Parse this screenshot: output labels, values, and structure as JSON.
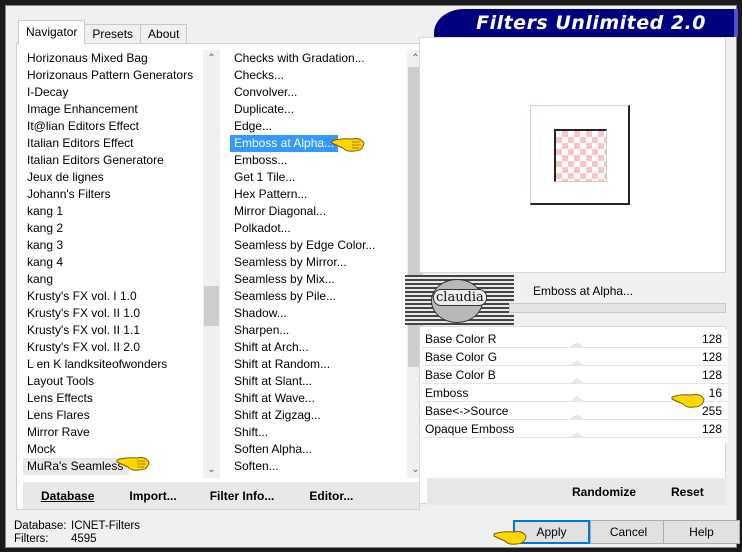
{
  "window": {
    "title": "Filters Unlimited 2.0"
  },
  "tabs": [
    {
      "label": "Navigator",
      "active": true
    },
    {
      "label": "Presets",
      "active": false
    },
    {
      "label": "About",
      "active": false
    }
  ],
  "categories": {
    "items": [
      "Horizonaus Mixed Bag",
      "Horizonaus Pattern Generators",
      "I-Decay",
      "Image Enhancement",
      "It@lian Editors Effect",
      "Italian Editors Effect",
      "Italian Editors Generatore",
      "Jeux de lignes",
      "Johann's Filters",
      "kang 1",
      "kang 2",
      "kang 3",
      "kang 4",
      "kang",
      "Krusty's FX vol. I 1.0",
      "Krusty's FX vol. II 1.0",
      "Krusty's FX vol. II 1.1",
      "Krusty's FX vol. II 2.0",
      "L en K landksiteofwonders",
      "Layout Tools",
      "Lens Effects",
      "Lens Flares",
      "Mirror Rave",
      "Mock",
      "MuRa's Seamless"
    ],
    "selected": "MuRa's Seamless",
    "scroll_position": 0.62
  },
  "filters": {
    "items": [
      "Checks with Gradation...",
      "Checks...",
      "Convolver...",
      "Duplicate...",
      "Edge...",
      "Emboss at Alpha...",
      "Emboss...",
      "Get 1 Tile...",
      "Hex Pattern...",
      "Mirror Diagonal...",
      "Polkadot...",
      "Seamless by Edge Color...",
      "Seamless by Mirror...",
      "Seamless by Mix...",
      "Seamless by Pile...",
      "Shadow...",
      "Sharpen...",
      "Shift at Arch...",
      "Shift at Random...",
      "Shift at Slant...",
      "Shift at Wave...",
      "Shift at Zigzag...",
      "Shift...",
      "Soften Alpha...",
      "Soften..."
    ],
    "selected": "Emboss at Alpha...",
    "scroll_position": 0.0
  },
  "left_buttons": {
    "database": "Database",
    "import": "Import...",
    "filter_info": "Filter Info...",
    "editor": "Editor..."
  },
  "filter_header": {
    "name": "Emboss at Alpha...",
    "logo_text": "claudia"
  },
  "params": [
    {
      "label": "Base Color R",
      "value": "128"
    },
    {
      "label": "Base Color G",
      "value": "128"
    },
    {
      "label": "Base Color B",
      "value": "128"
    },
    {
      "label": "Emboss",
      "value": "16"
    },
    {
      "label": "Base<->Source",
      "value": "255"
    },
    {
      "label": "Opaque Emboss",
      "value": "128"
    }
  ],
  "right_buttons": {
    "randomize": "Randomize",
    "reset": "Reset"
  },
  "status": {
    "database_label": "Database:",
    "database_value": "ICNET-Filters",
    "filters_label": "Filters:",
    "filters_value": "4595"
  },
  "dialog_buttons": {
    "apply": "Apply",
    "cancel": "Cancel",
    "help": "Help"
  },
  "colors": {
    "banner": "#00007f",
    "selection": "#3399ff",
    "default_button_border": "#0078d7"
  }
}
